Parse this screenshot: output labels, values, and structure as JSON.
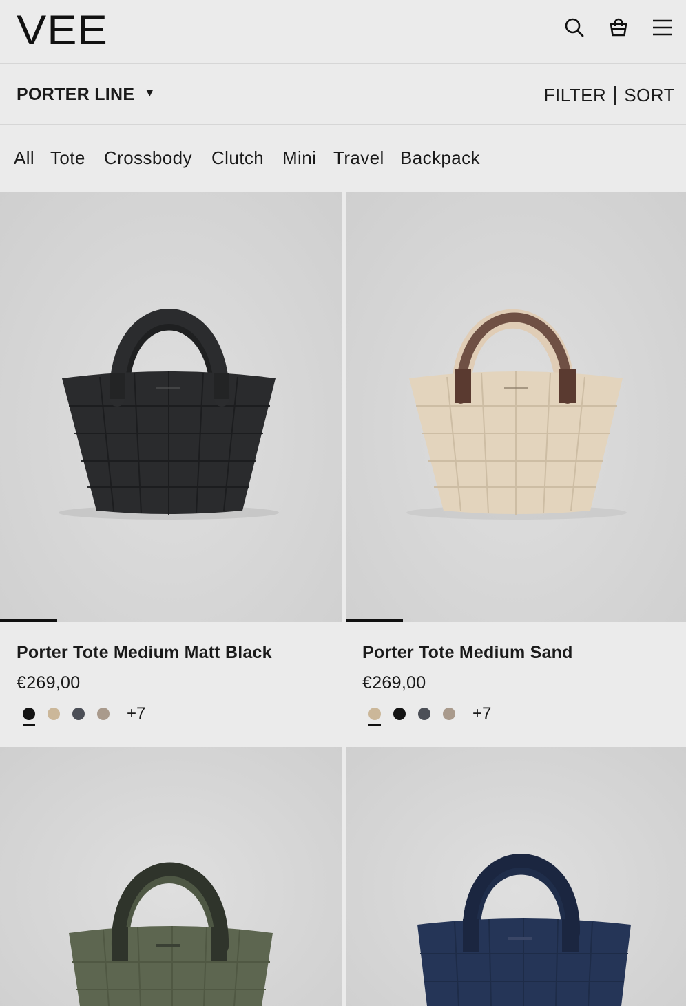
{
  "header": {
    "logo": "VEE",
    "icons": [
      "search-icon",
      "bag-icon",
      "menu-icon"
    ]
  },
  "collection_bar": {
    "title": "PORTER LINE",
    "caret": "▼",
    "filter": "FILTER",
    "sort": "SORT"
  },
  "categories": [
    "All",
    "Tote",
    "Crossbody",
    "Clutch",
    "Mini",
    "Travel",
    "Backpack"
  ],
  "products": [
    {
      "name": "Porter Tote Medium Matt Black",
      "price": "€269,00",
      "swatches": [
        "#141414",
        "#cbb799",
        "#4c4f57",
        "#a99a8c"
      ],
      "active_swatch": 0,
      "more": "+7",
      "bag_color": "#2a2b2d",
      "handle_color": "#232425"
    },
    {
      "name": "Porter Tote Medium Sand",
      "price": "€269,00",
      "swatches": [
        "#cbb799",
        "#141414",
        "#4c4f57",
        "#a99a8c"
      ],
      "active_swatch": 0,
      "more": "+7",
      "bag_color": "#e3d4bd",
      "handle_color": "#5a3a30"
    },
    {
      "bag_color": "#5d6650",
      "handle_color": "#2f342b"
    },
    {
      "bag_color": "#253557",
      "handle_color": "#1b2640"
    }
  ],
  "carousel_progress": [
    0.17,
    0.17
  ]
}
